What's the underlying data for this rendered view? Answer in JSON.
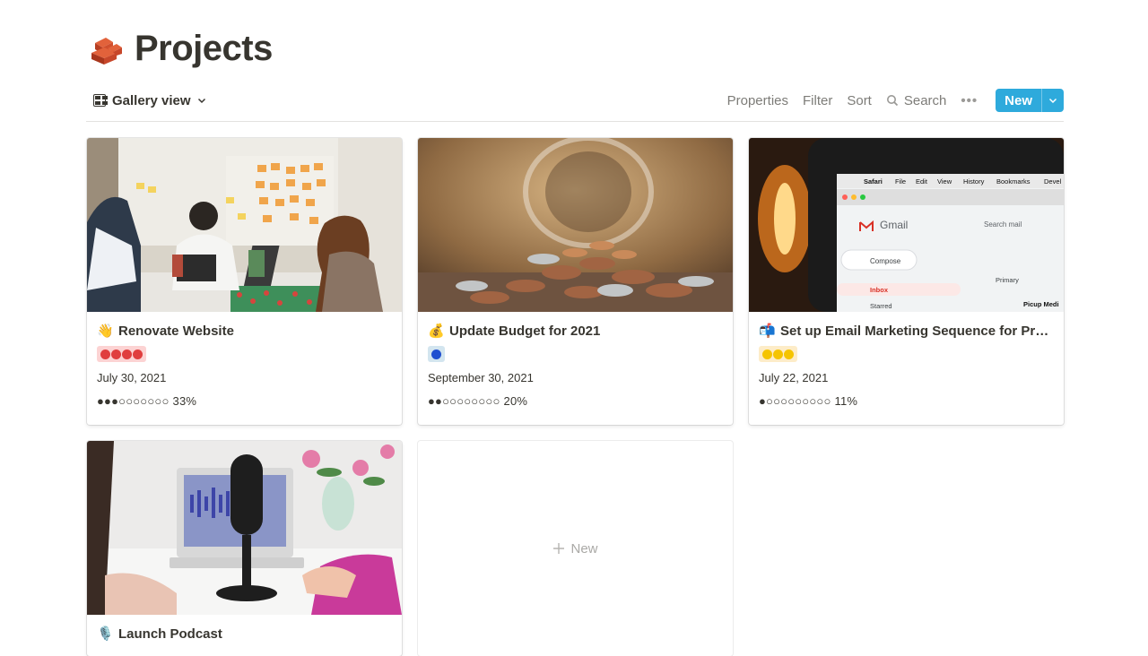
{
  "page": {
    "title": "Projects",
    "icon": "bricks-icon"
  },
  "toolbar": {
    "view_label": "Gallery view",
    "properties": "Properties",
    "filter": "Filter",
    "sort": "Sort",
    "search": "Search",
    "more": "•••",
    "new_label": "New"
  },
  "cards": [
    {
      "emoji": "👋",
      "title": "Renovate Website",
      "priority": {
        "count": 4,
        "color": "#e03e3e",
        "bg": "#fcd3d3"
      },
      "date": "July 30, 2021",
      "progress": {
        "dots": "●●●○○○○○○○",
        "percent_label": "33%",
        "value": 0.33
      }
    },
    {
      "emoji": "💰",
      "title": "Update Budget for 2021",
      "priority": {
        "count": 1,
        "color": "#1f4fd0",
        "bg": "#d3e5ef"
      },
      "date": "September 30, 2021",
      "progress": {
        "dots": "●●○○○○○○○○",
        "percent_label": "20%",
        "value": 0.2
      }
    },
    {
      "emoji": "📬",
      "title": "Set up Email Marketing Sequence for Pro…",
      "priority": {
        "count": 3,
        "color": "#f5c400",
        "bg": "#fdecc8"
      },
      "date": "July 22, 2021",
      "progress": {
        "dots": "●○○○○○○○○○",
        "percent_label": "11%",
        "value": 0.11
      }
    },
    {
      "emoji": "🎙️",
      "title": "Launch Podcast"
    }
  ],
  "new_card_label": "New",
  "cover_texts": {
    "safari_menu": [
      "Safari",
      "File",
      "Edit",
      "View",
      "History",
      "Bookmarks",
      "Devel"
    ],
    "gmail": "Gmail",
    "search_mail": "Search mail",
    "compose": "Compose",
    "primary": "Primary",
    "inbox": "Inbox",
    "starred": "Starred",
    "picup": "Picup Medi"
  },
  "colors": {
    "accent": "#2eaadc",
    "text": "#37352f",
    "muted": "#9b9a97"
  }
}
